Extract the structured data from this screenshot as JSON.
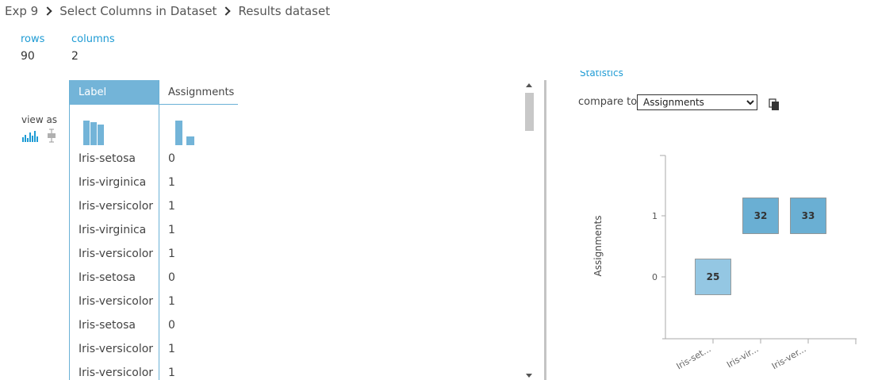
{
  "breadcrumb": {
    "items": [
      "Exp 9",
      "Select Columns in Dataset",
      "Results dataset"
    ]
  },
  "stats": {
    "rows_label": "rows",
    "rows_value": "90",
    "columns_label": "columns",
    "columns_value": "2"
  },
  "view_as": {
    "label": "view as",
    "icons": [
      "histogram-icon",
      "boxplot-icon"
    ]
  },
  "table": {
    "columns": [
      "Label",
      "Assignments"
    ],
    "selected_column": "Label",
    "rows": [
      [
        "Iris-setosa",
        "0"
      ],
      [
        "Iris-virginica",
        "1"
      ],
      [
        "Iris-versicolor",
        "1"
      ],
      [
        "Iris-virginica",
        "1"
      ],
      [
        "Iris-versicolor",
        "1"
      ],
      [
        "Iris-setosa",
        "0"
      ],
      [
        "Iris-versicolor",
        "1"
      ],
      [
        "Iris-setosa",
        "0"
      ],
      [
        "Iris-versicolor",
        "1"
      ],
      [
        "Iris-versicolor",
        "1"
      ]
    ]
  },
  "right_panel": {
    "cut_text": "Statistics",
    "compare_label": "compare to",
    "compare_selected": "Assignments",
    "copy_icon": "copy-icon"
  },
  "colors": {
    "accent": "#1e9bd4",
    "header_active": "#73b4d8",
    "bar": "#73b4d8",
    "cell_dark": "#6aafd3",
    "cell_light": "#94c7e3"
  },
  "chart_data": {
    "type": "heatmap",
    "title": "",
    "xlabel": "",
    "ylabel": "Assignments",
    "x_categories": [
      "Iris-set...",
      "Iris-vir...",
      "Iris-ver..."
    ],
    "y_categories": [
      "0",
      "1"
    ],
    "cells": [
      {
        "x": "Iris-set...",
        "y": "0",
        "value": 25
      },
      {
        "x": "Iris-vir...",
        "y": "1",
        "value": 32
      },
      {
        "x": "Iris-ver...",
        "y": "1",
        "value": 33
      }
    ]
  }
}
